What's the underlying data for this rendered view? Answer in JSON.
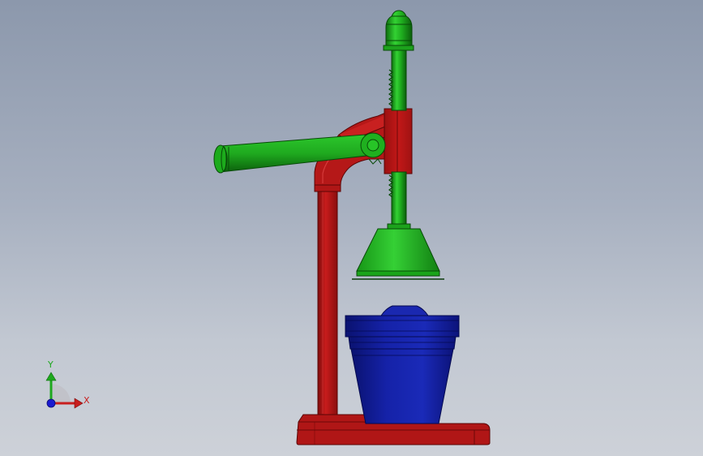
{
  "viewport": {
    "background_top": "#8c98ac",
    "background_bottom": "#cdd1d8"
  },
  "model": {
    "parts": [
      {
        "name": "lever-handle",
        "color": "#1fae1f"
      },
      {
        "name": "plunger-rod",
        "color": "#1fae1f"
      },
      {
        "name": "press-cone",
        "color": "#1fae1f"
      },
      {
        "name": "frame-column",
        "color": "#b01414"
      },
      {
        "name": "base-plate",
        "color": "#b01414"
      },
      {
        "name": "juice-cup",
        "color": "#10188c"
      }
    ]
  },
  "triad": {
    "y_label": "Y",
    "x_label": "X",
    "y_color": "#1ea81e",
    "x_color": "#c81e1e",
    "z_color": "#1a1ad0"
  }
}
